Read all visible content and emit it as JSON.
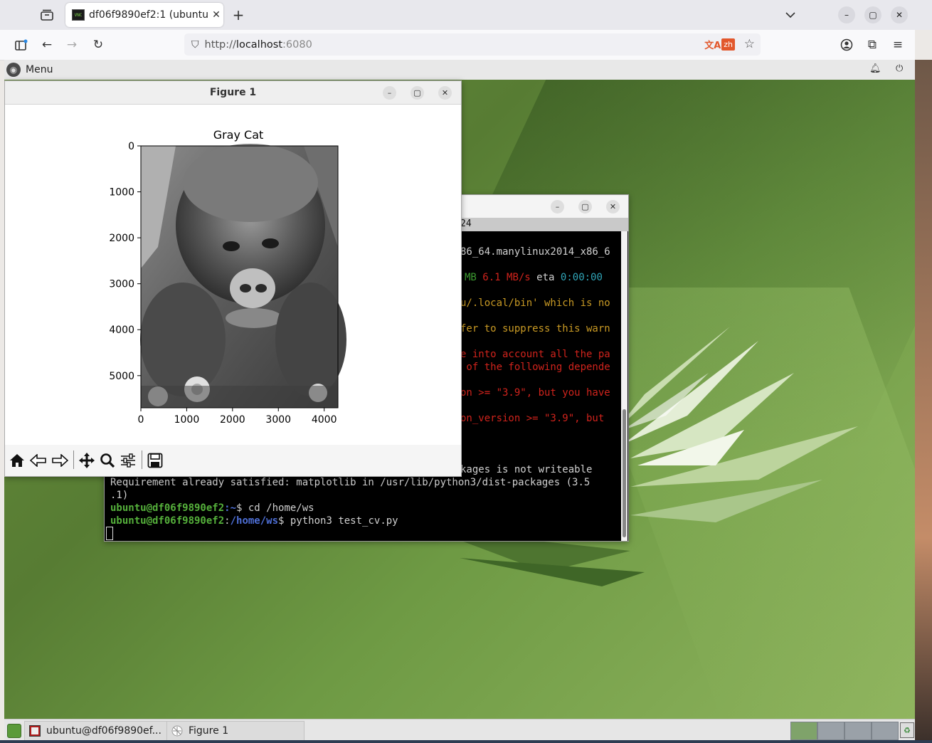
{
  "browser": {
    "tab_title": "df06f9890ef2:1 (ubuntu)",
    "favicon_text": "VNC",
    "url_protocol": "http://",
    "url_host": "localhost",
    "url_port": ":6080",
    "translate_lang": "zh"
  },
  "desktop_panel": {
    "menu_label": "Menu"
  },
  "figure_window": {
    "title": "Figure 1",
    "plot_title": "Gray Cat",
    "y_ticks": [
      "0",
      "1000",
      "2000",
      "3000",
      "4000",
      "5000"
    ],
    "x_ticks": [
      "0",
      "1000",
      "2000",
      "3000",
      "4000"
    ],
    "image_size": {
      "width": 4300,
      "height": 5700
    }
  },
  "terminal": {
    "tab_fragment": "24",
    "lines": {
      "l1": "86_64.manylinux2014_x86_6",
      "l2a": "MB",
      "l2b": "6.1 MB/s",
      "l2c": "eta",
      "l2d": "0:00:00",
      "l3": "u/.local/bin' which is no",
      "l4": "fer to suppress this warn",
      "l5": "e into account all the pa",
      "l6": " of the following depende",
      "l7": "on >= \"3.9\", but you have",
      "l8": "on_version >= \"3.9\", but ",
      "l9": "kages is not writeable",
      "l10": "Requirement already satisfied: matplotlib in /usr/lib/python3/dist-packages (3.5",
      "l11": ".1)",
      "prompt1_user": "ubuntu@df06f9890ef2",
      "prompt1_path": ":~",
      "prompt1_cmd": "$ cd /home/ws",
      "prompt2_user": "ubuntu@df06f9890ef2",
      "prompt2_colon": ":",
      "prompt2_path": "/home/ws",
      "prompt2_cmd": "$ python3 test_cv.py"
    }
  },
  "taskbar": {
    "terminal_task": "ubuntu@df06f9890ef...",
    "figure_task": "Figure 1"
  },
  "colors": {
    "desktop_green": "#6a8f3e",
    "prompt_green": "#55b03b",
    "path_blue": "#4e6fd6",
    "error_red": "#d0231c",
    "warn_orange": "#c99a24"
  }
}
